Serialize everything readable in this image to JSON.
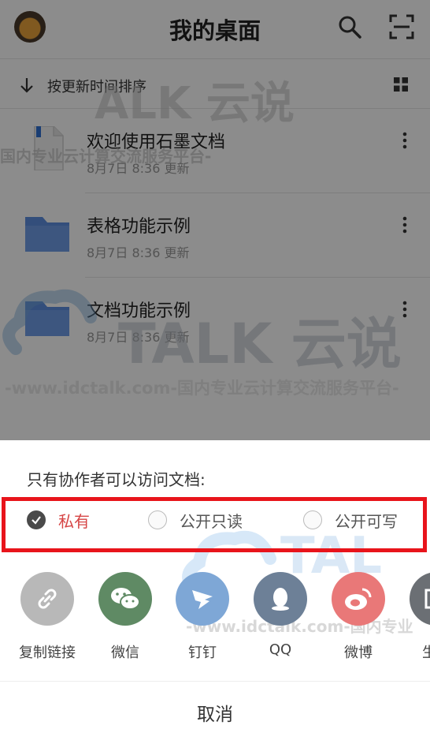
{
  "header": {
    "title": "我的桌面"
  },
  "sort": {
    "label": "按更新时间排序"
  },
  "files": [
    {
      "name": "欢迎使用石墨文档",
      "meta": "8月7日 8:36 更新",
      "icon": "document-icon"
    },
    {
      "name": "表格功能示例",
      "meta": "8月7日 8:36 更新",
      "icon": "folder-icon"
    },
    {
      "name": "文档功能示例",
      "meta": "8月7日 8:36 更新",
      "icon": "folder-icon"
    }
  ],
  "watermarks": {
    "brand": "ALK 云说",
    "tagline": "国内专业云计算交流服务平台-",
    "brand_large": "TALK 云说",
    "url_line": "-www.idctalk.com-国内专业云计算交流服务平台-",
    "brand_sheet": "TAL",
    "url_sheet": "-www.idctalk.com-国内专业"
  },
  "sheet": {
    "title": "只有协作者可以访问文档:",
    "options": [
      {
        "label": "私有",
        "checked": true
      },
      {
        "label": "公开只读",
        "checked": false
      },
      {
        "label": "公开可写",
        "checked": false
      }
    ],
    "share": [
      {
        "label": "复制链接",
        "icon": "link-icon",
        "color": "#b8b8b8"
      },
      {
        "label": "微信",
        "icon": "wechat-icon",
        "color": "#5f8a64"
      },
      {
        "label": "钉钉",
        "icon": "dingtalk-icon",
        "color": "#7ea7d6"
      },
      {
        "label": "QQ",
        "icon": "qq-icon",
        "color": "#6d8097"
      },
      {
        "label": "微博",
        "icon": "weibo-icon",
        "color": "#e97878"
      },
      {
        "label": "生成",
        "icon": "image-icon",
        "color": "#6b6f74"
      }
    ],
    "cancel": "取消"
  }
}
